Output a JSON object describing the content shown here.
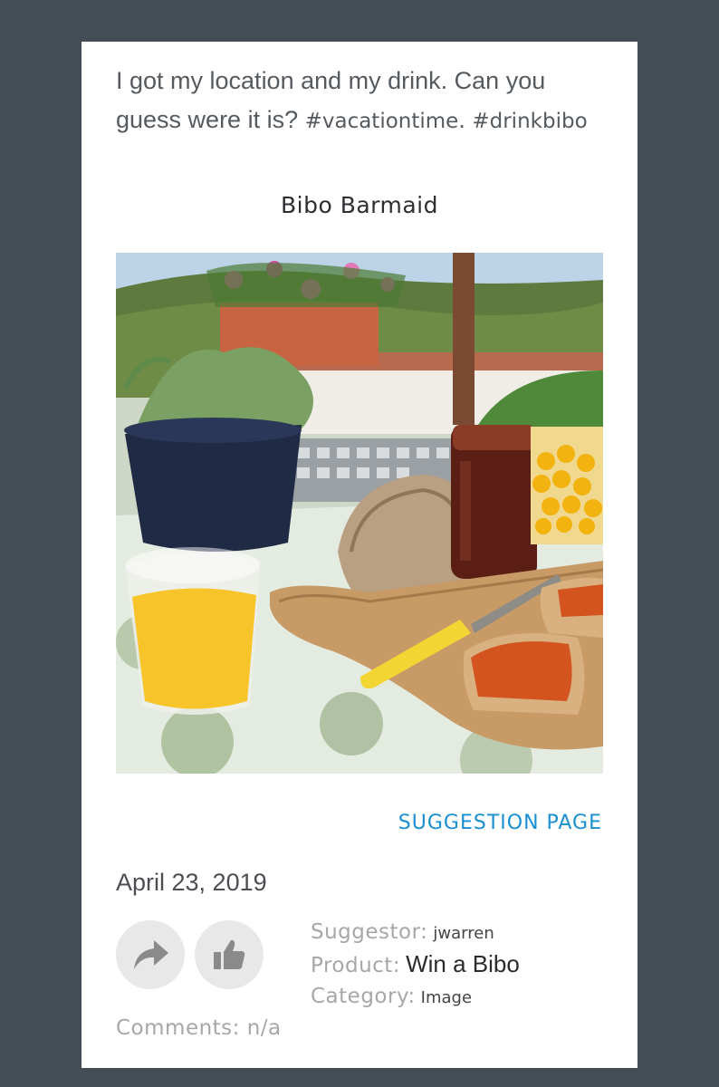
{
  "post": {
    "caption_text": "I got my location and my drink. Can you guess were it is? ",
    "hashtag_1": "#vacationtime",
    "caption_mid": ". ",
    "hashtag_2": "#drinkbibo",
    "author": "Bibo Barmaid"
  },
  "photo": {
    "icon": "breakfast-table-photo"
  },
  "links": {
    "suggestion_page": "SUGGESTION PAGE"
  },
  "date": "April 23, 2019",
  "actions": {
    "share_icon": "share-arrow-icon",
    "like_icon": "thumbs-up-icon"
  },
  "meta": {
    "suggestor_label": "Suggestor:",
    "suggestor_value": "jwarren",
    "product_label": "Product:",
    "product_value": "Win a Bibo",
    "category_label": "Category:",
    "category_value": "Image",
    "comments_label": "Comments:",
    "comments_value": "n/a"
  },
  "colors": {
    "page_background": "#444d56",
    "card_background": "#ffffff",
    "link": "#1a8fd1"
  }
}
